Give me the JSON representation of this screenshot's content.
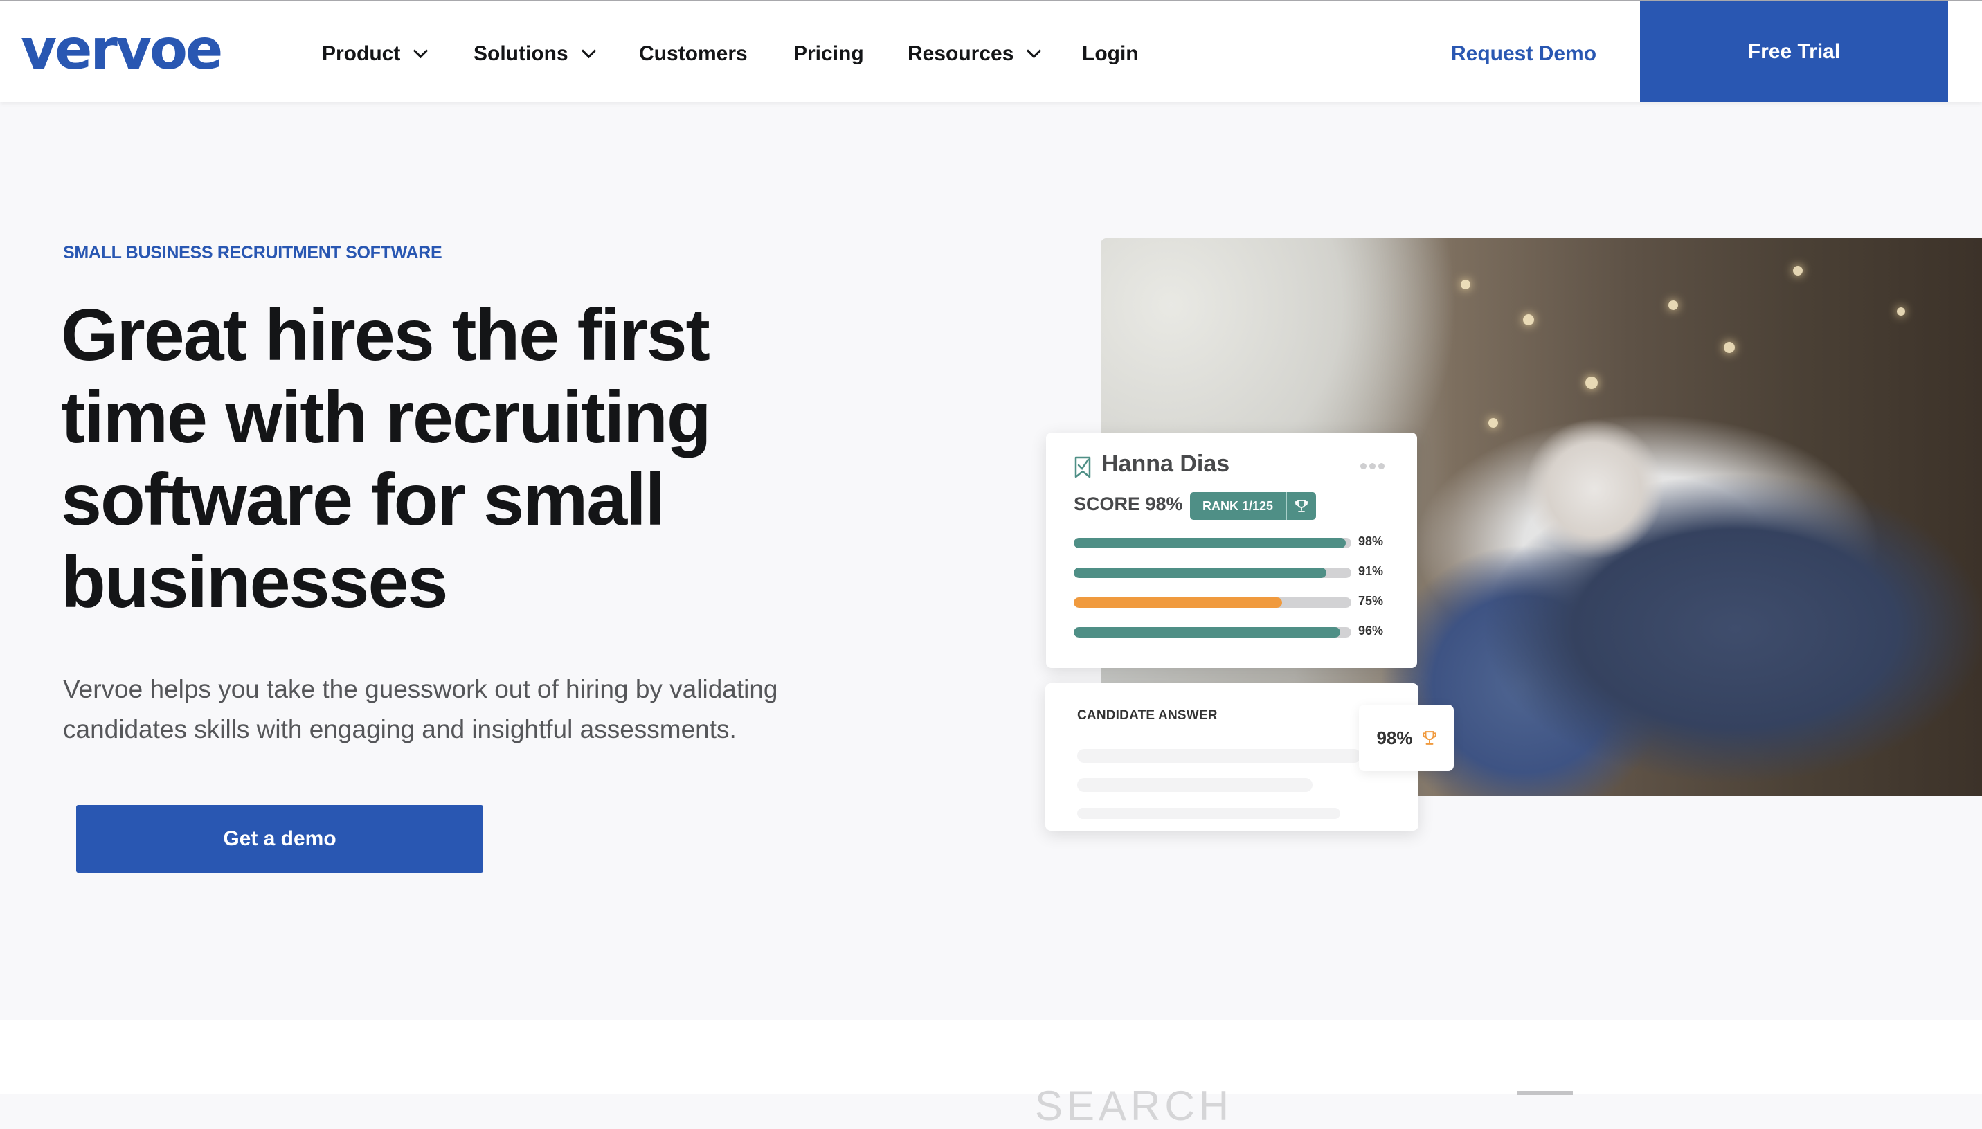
{
  "nav": {
    "logo": "vervoe",
    "items": [
      {
        "label": "Product",
        "has_dropdown": true
      },
      {
        "label": "Solutions",
        "has_dropdown": true
      },
      {
        "label": "Customers",
        "has_dropdown": false
      },
      {
        "label": "Pricing",
        "has_dropdown": false
      },
      {
        "label": "Resources",
        "has_dropdown": true
      },
      {
        "label": "Login",
        "has_dropdown": false
      }
    ],
    "request_demo": "Request Demo",
    "free_trial": "Free Trial"
  },
  "hero": {
    "eyebrow": "SMALL BUSINESS RECRUITMENT SOFTWARE",
    "title": "Great hires the first time with recruiting software for small businesses",
    "subtitle": "Vervoe helps you take the guesswork out of hiring by validating candidates skills with engaging and insightful assessments.",
    "cta": "Get a demo"
  },
  "candidate_card": {
    "name": "Hanna Dias",
    "score_label": "SCORE 98%",
    "rank": "RANK 1/125",
    "icons": {
      "bookmark": "bookmark-check-icon",
      "more": "more-dots-icon",
      "rank": "trophy-icon"
    },
    "bars": [
      {
        "label": "98%",
        "value": 98,
        "color": "#4f8f86"
      },
      {
        "label": "91%",
        "value": 91,
        "color": "#4f8f86"
      },
      {
        "label": "75%",
        "value": 75,
        "color": "#f09a3e"
      },
      {
        "label": "96%",
        "value": 96,
        "color": "#4f8f86"
      }
    ]
  },
  "answer_card": {
    "title": "CANDIDATE ANSWER",
    "score": "98%",
    "score_icon": "trophy-icon"
  },
  "next_section": {
    "heading_partial": "SEARCH"
  },
  "colors": {
    "brand_blue": "#2957b2",
    "teal": "#4f8f86",
    "orange": "#f09a3e",
    "text_dark": "#141517",
    "text_muted": "#555659"
  }
}
